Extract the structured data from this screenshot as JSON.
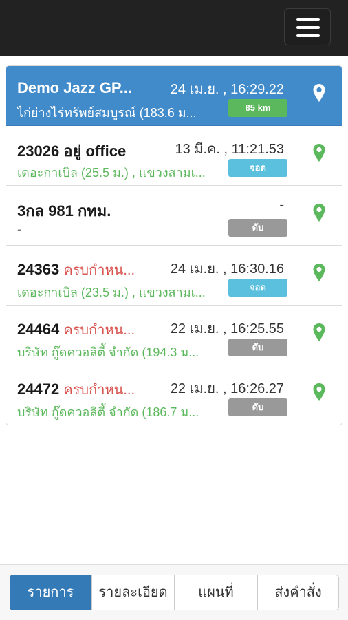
{
  "header": {
    "menu_icon": "hamburger-menu-icon"
  },
  "vehicles": [
    {
      "name": "Demo Jazz GP...",
      "status": "",
      "time": "24 เม.ย. , 16:29.22",
      "address": "ไก่ย่างไร่ทรัพย์สมบูรณ์ (183.6 ม...",
      "badge": "85 km",
      "badge_color": "#5cb85c",
      "active": true
    },
    {
      "name": "23026 อยู่ office",
      "status": "",
      "time": "13 มี.ค. , 11:21.53",
      "address": "เดอะกาเบิล (25.5 ม.) , แขวงสามเ...",
      "badge": "จอด",
      "badge_color": "#5bc0de",
      "active": false
    },
    {
      "name": "3กล 981 กทม.",
      "status": "",
      "time": "-",
      "address": "-",
      "badge": "ดับ",
      "badge_color": "#999999",
      "active": false
    },
    {
      "name": "24363",
      "status": "ครบกำหน...",
      "time": "24 เม.ย. , 16:30.16",
      "address": "เดอะกาเบิล (23.5 ม.) , แขวงสามเ...",
      "badge": "จอด",
      "badge_color": "#5bc0de",
      "active": false
    },
    {
      "name": "24464",
      "status": "ครบกำหน...",
      "time": "22 เม.ย. , 16:25.55",
      "address": "บริษัท กู๊ดควอลิตี้ จำกัด (194.3 ม...",
      "badge": "ดับ",
      "badge_color": "#999999",
      "active": false
    },
    {
      "name": "24472",
      "status": "ครบกำหน...",
      "time": "22 เม.ย. , 16:26.27",
      "address": "บริษัท กู๊ดควอลิตี้ จำกัด (186.7 ม...",
      "badge": "ดับ",
      "badge_color": "#999999",
      "active": false
    }
  ],
  "tabs": [
    {
      "label": "รายการ",
      "active": true
    },
    {
      "label": "รายละเอียด",
      "active": false
    },
    {
      "label": "แผนที่",
      "active": false
    },
    {
      "label": "ส่งคำสั่ง",
      "active": false
    }
  ],
  "colors": {
    "primary": "#428bca",
    "pin_green": "#5cb85c",
    "status_red": "#d9534f",
    "address_green": "#5cb85c"
  }
}
